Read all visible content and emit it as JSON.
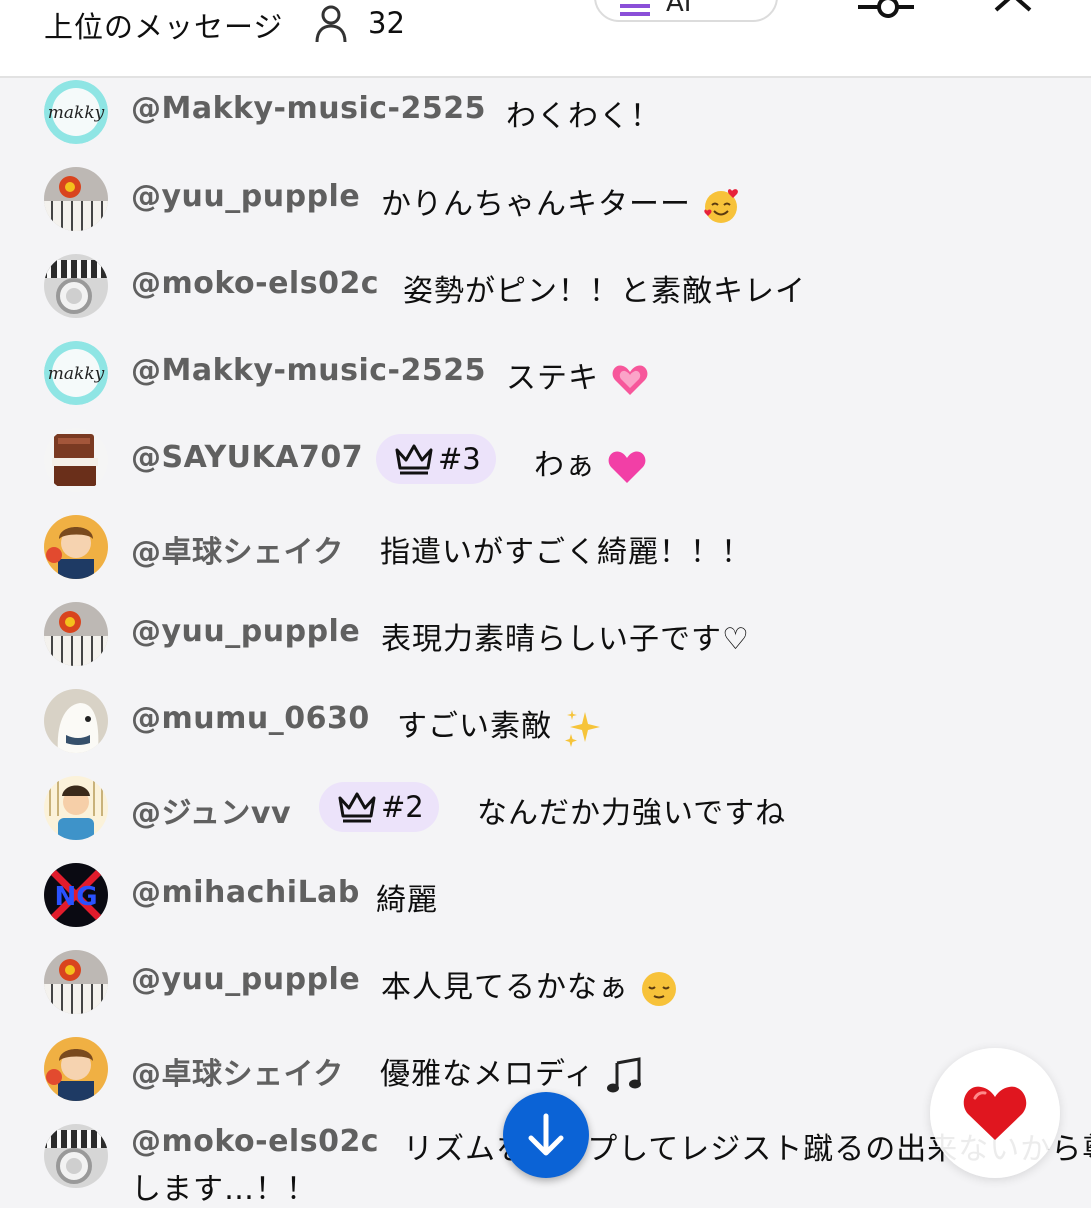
{
  "header": {
    "title": "上位のメッセージ",
    "viewer_count": "32",
    "ai_label": "AI"
  },
  "messages": [
    {
      "author": "@Makky-music-2525",
      "text": "わくわく！",
      "avatar": "makky-logo",
      "emoji": ""
    },
    {
      "author": "@yuu_pupple",
      "text": "かりんちゃんキターー",
      "avatar": "keyboard-doll",
      "emoji": "smiling-hearts"
    },
    {
      "author": "@moko-els02c",
      "text": "姿勢がピン！！と素敵キレイ",
      "avatar": "headphones-piano",
      "emoji": ""
    },
    {
      "author": "@Makky-music-2525",
      "text": "ステキ",
      "avatar": "makky-logo",
      "emoji": "growing-heart"
    },
    {
      "author": "@SAYUKA707",
      "text": "わぁ",
      "avatar": "electone",
      "emoji": "pink-heart",
      "badge": "#3"
    },
    {
      "author": "@卓球シェイク",
      "text": "指遣いがすごく綺麗！！！",
      "avatar": "anime-boy",
      "emoji": ""
    },
    {
      "author": "@yuu_pupple",
      "text": "表現力素晴らしい子です♡",
      "avatar": "keyboard-doll",
      "emoji": ""
    },
    {
      "author": "@mumu_0630",
      "text": "すごい素敵",
      "avatar": "white-dog",
      "emoji": "sparkles"
    },
    {
      "author": "@ジュンvv",
      "text": "なんだか力強いですね",
      "avatar": "cartoon-man",
      "emoji": "",
      "badge": "#2"
    },
    {
      "author": "@mihachiLab",
      "text": "綺麗",
      "avatar": "ng-logo",
      "emoji": ""
    },
    {
      "author": "@yuu_pupple",
      "text": "本人見てるかなぁ",
      "avatar": "keyboard-doll",
      "emoji": "relieved-face"
    },
    {
      "author": "@卓球シェイク",
      "text": "優雅なメロディ",
      "avatar": "anime-boy",
      "emoji": "musical-notes"
    },
    {
      "author": "@moko-els02c",
      "text": "リズムをキープしてレジスト蹴るの出来ないから尊敬",
      "text2": "します…！！",
      "avatar": "headphones-piano",
      "emoji": ""
    }
  ],
  "icons": {
    "viewer": "person-icon",
    "scroll_down": "arrow-down-icon",
    "reaction": "red-heart-icon",
    "filter": "filter-icon",
    "close": "close-icon",
    "badge": "crown-icon"
  },
  "colors": {
    "accent": "#0b63d6",
    "badge_bg": "#ece3fa",
    "author": "#606060",
    "heart": "#e0161f"
  }
}
